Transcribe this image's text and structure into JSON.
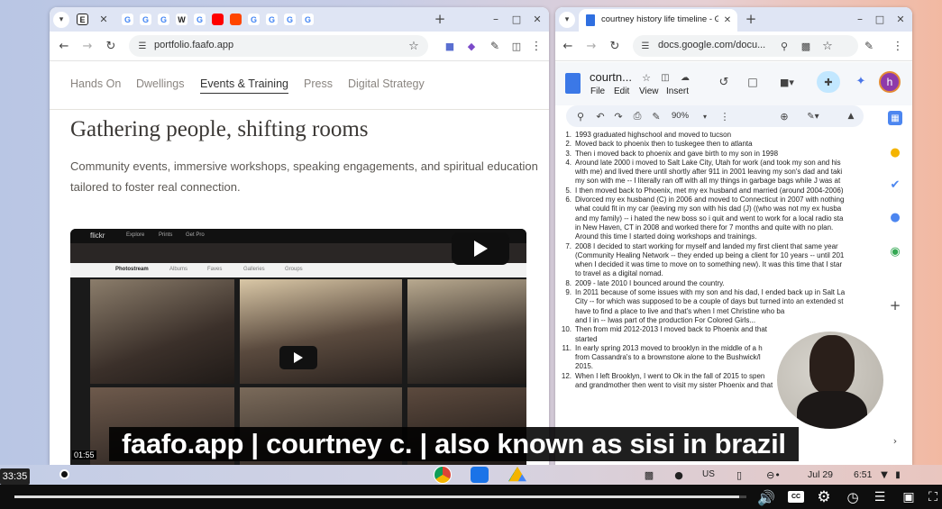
{
  "browser_left": {
    "tabs": [
      {
        "icon": "chevron-down-icon"
      },
      {
        "icon": "E"
      },
      {
        "icon": "close-icon"
      },
      {
        "icon": "G"
      },
      {
        "icon": "G"
      },
      {
        "icon": "G"
      },
      {
        "icon": "W"
      },
      {
        "icon": "G"
      },
      {
        "icon": "youtube-icon"
      },
      {
        "icon": "reddit-icon"
      },
      {
        "icon": "G"
      },
      {
        "icon": "G"
      },
      {
        "icon": "G"
      },
      {
        "icon": "G"
      }
    ],
    "url": "portfolio.faafo.app",
    "nav": [
      "Hands On",
      "Dwellings",
      "Events & Training",
      "Press",
      "Digital Strategy"
    ],
    "active_nav": "Events & Training",
    "heading": "Gathering people, shifting rooms",
    "subheading": "Community events, immersive workshops, speaking engagements, and spiritual education tailored to foster real connection.",
    "video": {
      "site_label": "flickr",
      "tabs": [
        "Photostream",
        "Albums",
        "Faves",
        "Galleries",
        "Groups"
      ],
      "menu": [
        "Explore",
        "Prints",
        "Get Pro"
      ],
      "duration": "01:55"
    }
  },
  "browser_right": {
    "tab_title": "courtney history life timeline - G",
    "url": "docs.google.com/docu...",
    "doc_title": "courtn...",
    "menu": [
      "File",
      "Edit",
      "View",
      "Insert"
    ],
    "zoom": "90%",
    "avatar_letter": "h",
    "lines": [
      {
        "n": "1.",
        "t": "1993 graduated highschool and moved to tucson"
      },
      {
        "n": "2.",
        "t": "Moved back to phoenix then to tuskegee then to atlanta"
      },
      {
        "n": "3.",
        "t": "Then i moved back to phoenix and gave birth to my son in 1998"
      },
      {
        "n": "4.",
        "t": "Around late 2000 i moved to Salt Lake City, Utah for work (and took my son and his"
      },
      {
        "n": "",
        "t": "with me) and lived there until shortly after 911 in 2001 leaving my son's dad and taki"
      },
      {
        "n": "",
        "t": "my son with me -- I literally ran off with all my things in garbage bags while J was at"
      },
      {
        "n": "5.",
        "t": "I then moved back to Phoenix, met my ex husband and married (around 2004-2006)"
      },
      {
        "n": "6.",
        "t": "Divorced my ex husband (C) in 2006 and moved to Connecticut in 2007 with nothing"
      },
      {
        "n": "",
        "t": "what could fit in my car (leaving my son with his dad (J) ((who was not my ex husba"
      },
      {
        "n": "",
        "t": "and my family) -- i hated the new boss so i quit and went to work for a local radio sta"
      },
      {
        "n": "",
        "t": "in New Haven, CT in 2008 and worked there for 7 months and quite with no plan."
      },
      {
        "n": "",
        "t": "Around this time I started doing workshops and trainings."
      },
      {
        "n": "7.",
        "t": "2008 I decided to start working for myself and landed my first client that same year"
      },
      {
        "n": "",
        "t": "(Community Healing Network -- they ended up being a client for 10 years -- until 201"
      },
      {
        "n": "",
        "t": "when I decided it was time to move on to something new). It was this time that I star"
      },
      {
        "n": "",
        "t": "to travel as a digital nomad."
      },
      {
        "n": "8.",
        "t": "2009 - late 2010 I bounced around the country."
      },
      {
        "n": "9.",
        "t": "In 2011 because of some issues with my son and his dad, I ended back up in Salt La"
      },
      {
        "n": "",
        "t": "City -- for which was supposed to be a couple of days but turned into an extended st"
      },
      {
        "n": "",
        "t": "have to find a place to live and that's when I met Christine who ba"
      },
      {
        "n": "",
        "t": "and I in -- Iwas part of the production For Colored Girls..."
      },
      {
        "n": "10.",
        "t": "Then from mid 2012-2013 I moved back to Phoenix and that"
      },
      {
        "n": "",
        "t": "started"
      },
      {
        "n": "11.",
        "t": "In early spring 2013 moved to brooklyn in the middle of a h"
      },
      {
        "n": "",
        "t": "from Cassandra's to a brownstone alone to the Bushwick/l"
      },
      {
        "n": "",
        "t": "2015."
      },
      {
        "n": "12.",
        "t": "When I left Brooklyn, I went to Ok in the fall of 2015 to spen"
      },
      {
        "n": "",
        "t": "and grandmother then went to visit my sister Phoenix and that"
      }
    ]
  },
  "caption": "faafo.app | courtney c. | also known as sisi in brazil",
  "shelf": {
    "ime": "US",
    "date": "Jul 29",
    "time": "6:51"
  },
  "player": {
    "current_time": "33:35",
    "progress": 0.99
  }
}
